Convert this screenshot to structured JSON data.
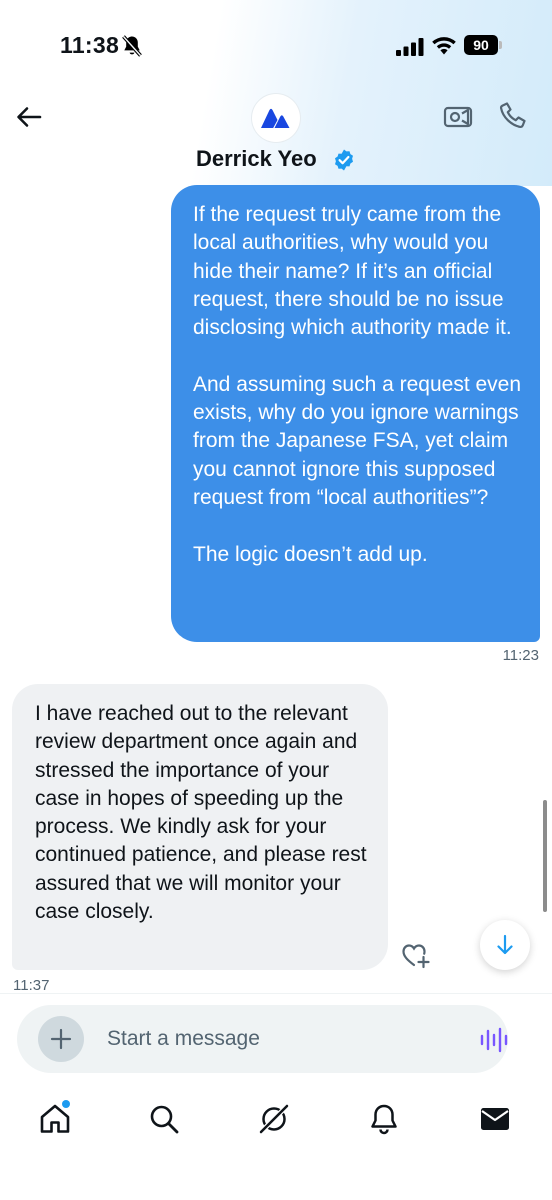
{
  "status_bar": {
    "time": "11:38",
    "battery": "90",
    "icons": [
      "bell-slash-icon",
      "cellular-signal-icon",
      "wifi-icon",
      "battery-icon"
    ]
  },
  "header": {
    "contact_name": "Derrick Yeo",
    "verified": true,
    "back_icon": "arrow-left-icon",
    "avatar_icon": "brand-logo",
    "actions": [
      "video-call-icon",
      "phone-icon"
    ]
  },
  "messages": [
    {
      "direction": "outgoing",
      "text": "If the request truly came from the local authorities, why would you hide their name? If it’s an official request, there should be no issue disclosing which authority made it.\n\nAnd assuming such a request even exists, why do you ignore warnings from the Japanese FSA, yet claim you cannot ignore this supposed request from “local authorities”?\n\nThe logic doesn’t add up.",
      "time": "11:23"
    },
    {
      "direction": "incoming",
      "text": "I have reached out to the relevant review department once again and stressed the importance of your case in hopes of speeding up the process. We kindly ask for your continued patience, and please rest assured that we will monitor your case closely.",
      "time": "11:37"
    }
  ],
  "composer": {
    "placeholder": "Start a message",
    "value": "",
    "add_icon": "plus-icon",
    "voice_icon": "voice-wave-icon"
  },
  "tabs": [
    {
      "name": "home",
      "icon": "home-icon",
      "active": true,
      "has_notification_dot": true
    },
    {
      "name": "search",
      "icon": "search-icon",
      "active": false
    },
    {
      "name": "grok",
      "icon": "grok-icon",
      "active": false
    },
    {
      "name": "notifications",
      "icon": "bell-icon",
      "active": false
    },
    {
      "name": "messages",
      "icon": "envelope-icon",
      "active": false
    }
  ],
  "colors": {
    "outgoing_bubble": "#3d8fe8",
    "incoming_bubble": "#eff1f3",
    "accent": "#1d9bf0",
    "voice_icon": "#7856ff"
  }
}
